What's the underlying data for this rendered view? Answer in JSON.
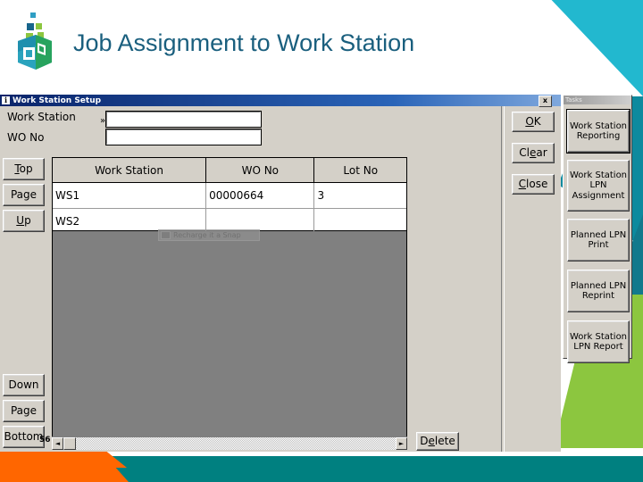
{
  "slide": {
    "title": "Job Assignment to Work Station",
    "title_color": "#1a5f7e",
    "logo_icon": "cube-logo-icon",
    "decor": {
      "cyan": "#22b8cf",
      "teal": "#008080",
      "green": "#8cc63f",
      "orange": "#ff6600"
    }
  },
  "app_window": {
    "title": "Work Station Setup",
    "title_icon": "info-icon",
    "close_label": "x",
    "form": {
      "work_station_label": "Work Station",
      "work_station_value": "",
      "work_station_placeholder": "",
      "work_station_marker": "»",
      "wo_no_label": "WO No",
      "wo_no_value": "",
      "wo_no_placeholder": ""
    },
    "nav_buttons_top": [
      {
        "label": "Top",
        "accel": "T"
      },
      {
        "label": "Page",
        "accel": ""
      },
      {
        "label": "Up",
        "accel": "U"
      }
    ],
    "nav_buttons_bottom": [
      {
        "label": "Down",
        "accel": ""
      },
      {
        "label": "Page",
        "accel": ""
      },
      {
        "label": "Bottom",
        "accel": ""
      }
    ],
    "action_buttons": [
      {
        "label_pre": "",
        "accel": "O",
        "label_post": "K",
        "full": "OK"
      },
      {
        "label_pre": "Cl",
        "accel": "e",
        "label_post": "ar",
        "full": "Clear"
      },
      {
        "label_pre": "",
        "accel": "C",
        "label_post": "lose",
        "full": "Close"
      }
    ],
    "delete_button": {
      "label_pre": "D",
      "accel": "e",
      "label_post": "lete",
      "full": "Delete"
    },
    "grid": {
      "columns": [
        "Work Station",
        "WO No",
        "Lot No"
      ],
      "rows": [
        [
          "WS1",
          "00000664",
          "3"
        ],
        [
          "WS2",
          "",
          ""
        ]
      ]
    },
    "ghost_element": {
      "label": "Recharge it a Snap",
      "icon": "disabled-tool-icon"
    },
    "scrollbar": {
      "left_arrow": "◄",
      "right_arrow": "►"
    },
    "status_fragment": "56"
  },
  "menu_panel": {
    "title": "Tasks",
    "buttons": [
      {
        "lines": [
          "Work Station",
          "Reporting"
        ],
        "focused": true
      },
      {
        "lines": [
          "Work Station",
          "LPN",
          "Assignment"
        ],
        "focused": false
      },
      {
        "lines": [
          "Planned LPN",
          "Print"
        ],
        "focused": false
      },
      {
        "lines": [
          "Planned LPN",
          "Reprint"
        ],
        "focused": false
      },
      {
        "lines": [
          "Work Station",
          "LPN Report"
        ],
        "focused": false
      }
    ]
  }
}
